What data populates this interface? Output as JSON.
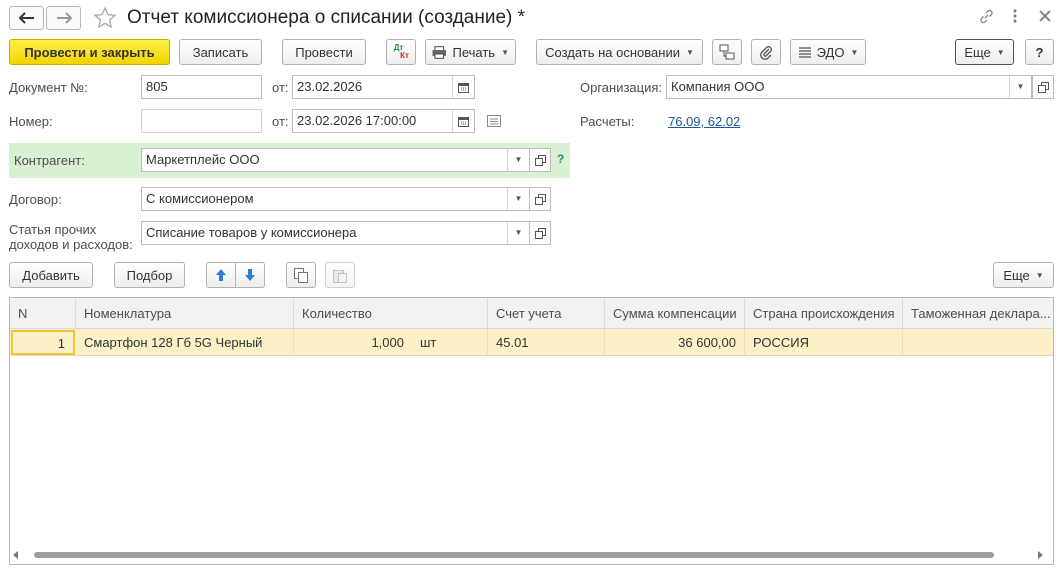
{
  "window": {
    "title": "Отчет комиссионера о списании (создание) *"
  },
  "toolbar": {
    "post_close": "Провести и закрыть",
    "save": "Записать",
    "post": "Провести",
    "dtkt_top": "Дт",
    "dtkt_bottom": "Кт",
    "print": "Печать",
    "create_based": "Создать на основании",
    "edo": "ЭДО",
    "more": "Еще",
    "help": "?"
  },
  "form": {
    "doc_no_label": "Документ №:",
    "doc_no_value": "805",
    "from_label": "от:",
    "doc_date": "23.02.2026",
    "number_label": "Номер:",
    "number_value": "",
    "from_label2": "от:",
    "number_datetime": "23.02.2026 17:00:00",
    "org_label": "Организация:",
    "org_value": "Компания ООО",
    "settlements_label": "Расчеты:",
    "settlements_link": "76.09, 62.02",
    "counterparty_label": "Контрагент:",
    "counterparty_value": "Маркетплейс ООО",
    "counterparty_help": "?",
    "contract_label": "Договор:",
    "contract_value": "С комиссионером",
    "expense_label_line1": "Статья прочих",
    "expense_label_line2": "доходов и расходов:",
    "expense_value": "Списание товаров у комиссионера"
  },
  "table_toolbar": {
    "add": "Добавить",
    "select": "Подбор",
    "more": "Еще"
  },
  "table": {
    "columns": [
      "N",
      "Номенклатура",
      "Количество",
      "Счет учета",
      "Сумма компенсации",
      "Страна происхождения",
      "Таможенная деклара..."
    ],
    "rows": [
      {
        "n": "1",
        "item": "Смартфон 128 Гб 5G Черный",
        "qty": "1,000",
        "unit": "шт",
        "account": "45.01",
        "amount": "36 600,00",
        "country": "РОССИЯ",
        "customs": ""
      }
    ]
  },
  "colors": {
    "primary_button": "#f5dc15",
    "counterparty_highlight": "#d9f0d3",
    "selected_row": "#fbf0c6",
    "link": "#1a57a0",
    "arrow_blue": "#2f7fd0"
  }
}
